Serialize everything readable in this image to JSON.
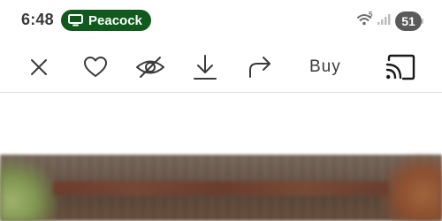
{
  "status_bar": {
    "time": "6:48",
    "active_app": {
      "label": "Peacock",
      "icon": "screen-icon",
      "color": "#0f5a1c"
    },
    "wifi": {
      "icon": "wifi-icon",
      "label": "5"
    },
    "signal": {
      "icon": "cellular-signal-icon"
    },
    "battery": {
      "level": "51",
      "color": "#5a5a5a"
    }
  },
  "toolbar": {
    "close": {
      "icon": "close-icon"
    },
    "favorite": {
      "icon": "heart-icon"
    },
    "hide": {
      "icon": "eye-slash-icon"
    },
    "download": {
      "icon": "download-icon"
    },
    "share": {
      "icon": "share-arrow-icon"
    },
    "buy_label": "Buy",
    "cast": {
      "icon": "cast-icon"
    }
  },
  "colors": {
    "text_dark": "#3a3a3a",
    "divider": "#dedede",
    "pill_green": "#0f5a1c"
  }
}
